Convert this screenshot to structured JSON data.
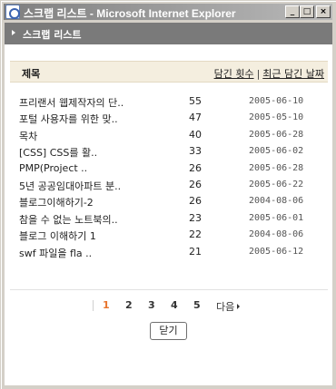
{
  "window": {
    "title": "스크랩 리스트 - Microsoft Internet Explorer",
    "minimize_label": "_",
    "maximize_label": "□",
    "close_label": "×"
  },
  "header": {
    "title": "스크랩 리스트"
  },
  "table": {
    "col_title": "제목",
    "sort_by_count": "담긴 횟수",
    "separator": "|",
    "sort_by_date": "최근 담긴 날짜",
    "rows": [
      {
        "title": "프리랜서 웹제작자의 단..",
        "count": "55",
        "date": "2005-06-10"
      },
      {
        "title": "포털 사용자를 위한 맞..",
        "count": "47",
        "date": "2005-05-10"
      },
      {
        "title": "목차",
        "count": "40",
        "date": "2005-06-28"
      },
      {
        "title": "[CSS] CSS를 활..",
        "count": "33",
        "date": "2005-06-02"
      },
      {
        "title": "PMP(Project ..",
        "count": "26",
        "date": "2005-06-28"
      },
      {
        "title": "5년 공공임대아파트 분..",
        "count": "26",
        "date": "2005-06-22"
      },
      {
        "title": "블로그이해하기-2",
        "count": "26",
        "date": "2004-08-06"
      },
      {
        "title": "참을 수 없는 노트북의..",
        "count": "23",
        "date": "2005-06-01"
      },
      {
        "title": "블로그 이해하기 1",
        "count": "22",
        "date": "2004-08-06"
      },
      {
        "title": "swf 파일을 fla ..",
        "count": "21",
        "date": "2005-06-12"
      }
    ]
  },
  "pager": {
    "pages": [
      "1",
      "2",
      "3",
      "4",
      "5"
    ],
    "current": "1",
    "next_label": "다음"
  },
  "footer": {
    "close_label": "닫기"
  },
  "colors": {
    "header_bg": "#7a7a7a",
    "table_head_bg": "#f4eedf",
    "active_page": "#e8742c"
  }
}
